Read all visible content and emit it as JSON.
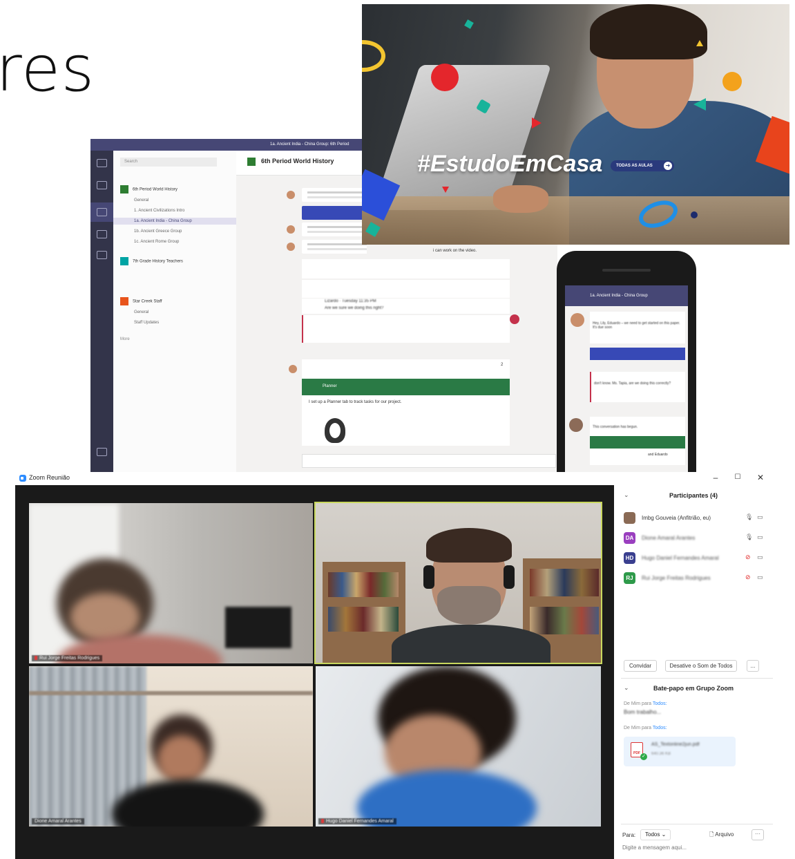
{
  "slide": {
    "title_fragment": "res"
  },
  "teams": {
    "window_title": "1a. Ancient India - China Group: 6th Period",
    "search_placeholder": "Search",
    "channel_header": "6th Period World History",
    "teams": [
      {
        "name": "6th Period World History",
        "color": "#2e7d32"
      },
      {
        "name": "7th Grade History Teachers",
        "color": "#00a4a4"
      },
      {
        "name": "Star Creek Staff",
        "color": "#e8541c"
      }
    ],
    "channels_team1": [
      "General",
      "1. Ancient Civilizations Intro",
      "1a. Ancient India - China Group",
      "1b. Ancient Greece Group",
      "1c. Ancient Rome Group"
    ],
    "channels_team3": [
      "General",
      "Staff Updates"
    ],
    "more_label": "More",
    "video_msg": "i can work on the video.",
    "planner_label": "Planner",
    "planner_msg": "I set up a Planner tab to track tasks for our project.",
    "lizardo_msg": "Lizardo · Tuesday 11:35 PM",
    "lizardo_body": "Are we sure we doing this right?",
    "likes": "2"
  },
  "phone": {
    "channel": "1a. Ancient India - China Group",
    "msg1": "Hey, Lily, Eduardo – we need to get started on this paper. It's due soon",
    "msg2": "don't know. Ms. Tapia, are we doing this correctly?",
    "conversation_started": "This conversation has begun.",
    "footer": "and Eduardo"
  },
  "banner": {
    "hashtag": "#EstudoEmCasa",
    "button_label": "TODAS AS AULAS",
    "button_arrow": "➜"
  },
  "zoom": {
    "window_title": "Zoom Reunião",
    "controls": {
      "minimize": "–",
      "maximize": "☐",
      "close": "✕"
    },
    "tiles": [
      {
        "label": "Rui Jorge Freitas Rodrigues",
        "active": false
      },
      {
        "label": "",
        "active": true
      },
      {
        "label": "Dione Amaral Arantes",
        "active": false
      },
      {
        "label": "Hugo Daniel Fernandes Amaral",
        "active": false
      }
    ],
    "participants": {
      "header": "Participantes (4)",
      "list": [
        {
          "initials": "",
          "name": "Imbg Gouveia (Anfitrião, eu)",
          "color": "#8a6a55",
          "muted": false
        },
        {
          "initials": "DA",
          "name": "Dione Amaral Arantes",
          "color": "#9a3fbf",
          "muted": false
        },
        {
          "initials": "HD",
          "name": "Hugo Daniel Fernandes Amaral",
          "color": "#3a3f8f",
          "muted": true
        },
        {
          "initials": "RJ",
          "name": "Rui Jorge Freitas Rodrigues",
          "color": "#2e9a4a",
          "muted": true
        }
      ],
      "invite_label": "Convidar",
      "mute_all_label": "Desative o Som de Todos",
      "more_label": "..."
    },
    "chat": {
      "header": "Bate-papo em Grupo Zoom",
      "msg1_meta": "De Mim para",
      "msg1_to": "Todos:",
      "msg1_text": "Bom trabalho...",
      "msg2_meta": "De Mim para",
      "msg2_to": "Todos:",
      "file_name": "AS_Textonline2jun.pdf",
      "file_size": "640.36 KB",
      "file_badge": "PDF",
      "to_label": "Para:",
      "to_value": "Todos",
      "file_button": "Arquivo",
      "more_button": "···",
      "input_placeholder": "Digite a mensagem aqui..."
    }
  }
}
